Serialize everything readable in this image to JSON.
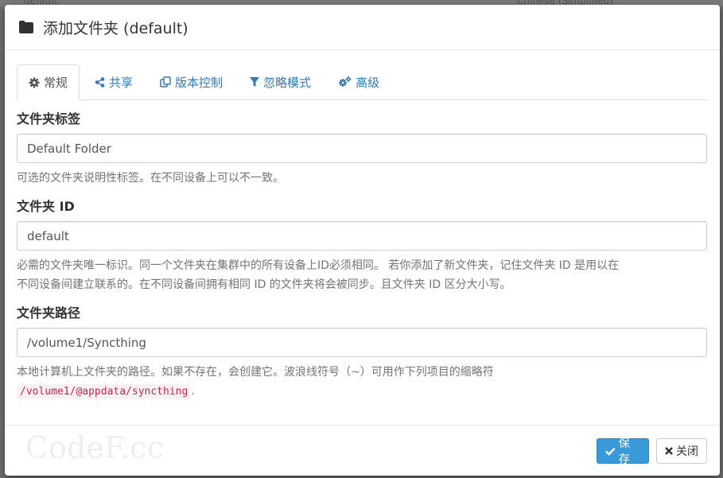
{
  "background": {
    "left_text": "default",
    "right_text": "Chinese (Simplified)"
  },
  "modal": {
    "title": "添加文件夹 (default)",
    "header_icon": "folder-icon"
  },
  "tabs": [
    {
      "label": "常规",
      "icon": "cog-icon",
      "active": true
    },
    {
      "label": "共享",
      "icon": "share-icon",
      "active": false
    },
    {
      "label": "版本控制",
      "icon": "copy-icon",
      "active": false
    },
    {
      "label": "忽略模式",
      "icon": "filter-icon",
      "active": false
    },
    {
      "label": "高级",
      "icon": "cogs-icon",
      "active": false
    }
  ],
  "fields": {
    "label": {
      "title": "文件夹标签",
      "value": "Default Folder",
      "help": "可选的文件夹说明性标签。在不同设备上可以不一致。"
    },
    "id": {
      "title": "文件夹 ID",
      "value": "default",
      "help_line1": "必需的文件夹唯一标识。同一个文件夹在集群中的所有设备上ID必须相同。 若你添加了新文件夹，记住文件夹 ID 是用以在",
      "help_line2": "不同设备间建立联系的。在不同设备间拥有相同 ID 的文件夹将会被同步。且文件夹 ID 区分大小写。"
    },
    "path": {
      "title": "文件夹路径",
      "value": "/volume1/Syncthing",
      "help": "本地计算机上文件夹的路径。如果不存在，会创建它。波浪线符号（~）可用作下列项目的缩略符",
      "code": "/volume1/@appdata/syncthing",
      "help_end": "."
    }
  },
  "footer": {
    "watermark": "CodeF.cc",
    "save_label": "保存",
    "close_label": "关闭"
  },
  "colors": {
    "link": "#337ab7",
    "primary_button": "#3a9ad9",
    "code_text": "#c7254e"
  }
}
